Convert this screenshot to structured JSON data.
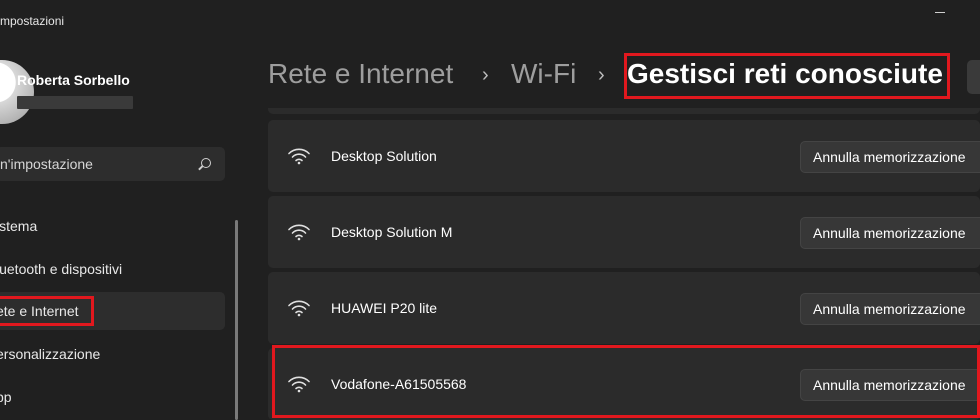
{
  "window": {
    "title": "mpostazioni"
  },
  "profile": {
    "name": "Roberta Sorbello"
  },
  "search": {
    "placeholder": "n'impostazione"
  },
  "nav": {
    "items": [
      {
        "label": "istema",
        "selected": false
      },
      {
        "label": "luetooth e dispositivi",
        "selected": false
      },
      {
        "label": "ete e Internet",
        "selected": true
      },
      {
        "label": "ersonalizzazione",
        "selected": false
      },
      {
        "label": "pp",
        "selected": false
      }
    ]
  },
  "breadcrumb": {
    "items": [
      "Rete e Internet",
      "Wi-Fi"
    ],
    "current": "Gestisci reti conosciute",
    "separator": "›"
  },
  "networks": [
    {
      "name": "Desktop Solution",
      "action": "Annulla memorizzazione"
    },
    {
      "name": "Desktop Solution M",
      "action": "Annulla memorizzazione"
    },
    {
      "name": "HUAWEI P20 lite",
      "action": "Annulla memorizzazione"
    },
    {
      "name": "Vodafone-A61505568",
      "action": "Annulla memorizzazione"
    }
  ],
  "colors": {
    "background": "#202020",
    "card": "#2b2b2b",
    "accent": "#60cdff",
    "annotation": "#e1181e"
  },
  "icons": {
    "search": "search-icon",
    "wifi": "wifi-icon",
    "minimize": "minimize-icon"
  }
}
